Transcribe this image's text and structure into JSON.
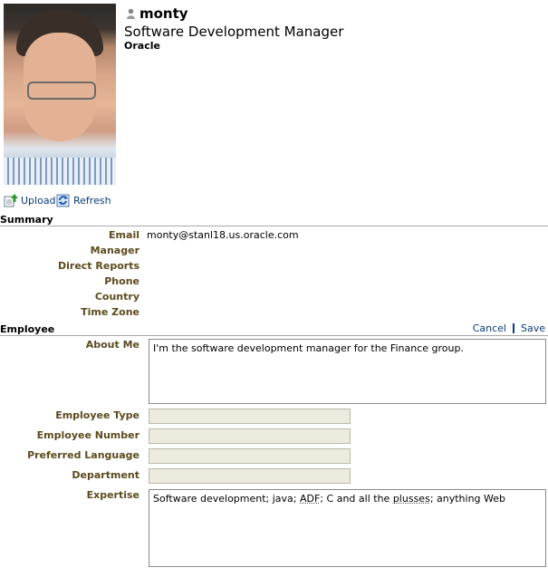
{
  "profile": {
    "name": "monty",
    "title": "Software Development Manager",
    "organization": "Oracle"
  },
  "toolbar": {
    "upload_label": "Upload",
    "refresh_label": "Refresh"
  },
  "summary": {
    "heading": "Summary",
    "email_label": "Email",
    "email_value": "monty@stanl18.us.oracle.com",
    "manager_label": "Manager",
    "direct_reports_label": "Direct Reports",
    "phone_label": "Phone",
    "country_label": "Country",
    "time_zone_label": "Time Zone"
  },
  "employee": {
    "heading": "Employee",
    "cancel_label": "Cancel",
    "save_label": "Save",
    "about_me_label": "About Me",
    "about_me_value": "I'm the software development manager for the Finance group.",
    "employee_type_label": "Employee Type",
    "employee_number_label": "Employee Number",
    "preferred_language_label": "Preferred Language",
    "department_label": "Department",
    "expertise_label": "Expertise",
    "expertise_parts": [
      "Software development; java; ",
      "ADF",
      "; C and all the ",
      "plusses",
      "; anything Web"
    ]
  },
  "colors": {
    "label": "#5b4a1d",
    "link": "#0a3a7a",
    "readonly_field": "#ecebdd"
  },
  "icons": [
    "user-presence-icon",
    "upload-icon",
    "refresh-icon"
  ]
}
